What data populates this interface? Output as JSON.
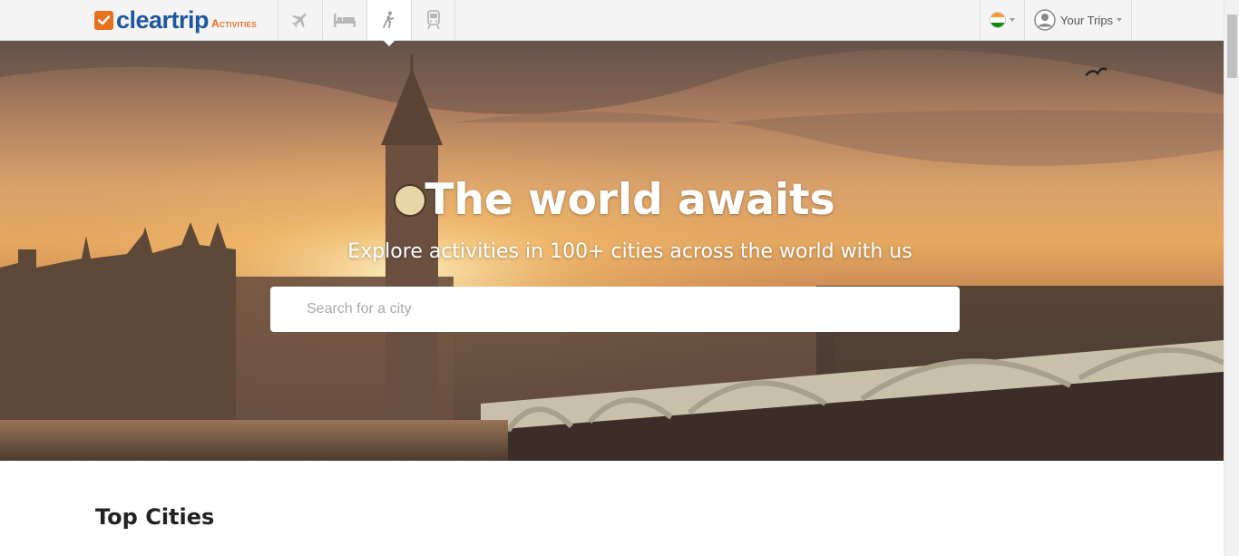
{
  "brand": {
    "name": "cleartrip",
    "sub": "Activities"
  },
  "nav": {
    "modes": [
      {
        "key": "flights",
        "icon": "airplane-icon"
      },
      {
        "key": "hotels",
        "icon": "bed-icon"
      },
      {
        "key": "activities",
        "icon": "walking-person-icon",
        "active": true
      },
      {
        "key": "trains",
        "icon": "train-icon"
      }
    ],
    "country_icon": "india-flag-icon",
    "trips_label": "Your Trips"
  },
  "hero": {
    "title": "The world awaits",
    "subtitle": "Explore activities in 100+ cities across the world with us",
    "search_placeholder": "Search for a city"
  },
  "sections": {
    "top_cities_title": "Top Cities"
  },
  "colors": {
    "brand_blue": "#1e56a0",
    "brand_orange": "#e8711d"
  }
}
